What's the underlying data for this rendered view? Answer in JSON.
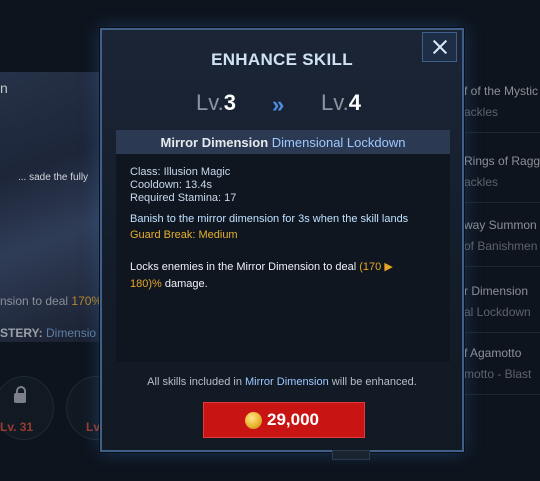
{
  "background": {
    "left_texts": {
      "top_fragment": "n",
      "art_caption": "... sade the fully",
      "deal_prefix": "nsion to deal ",
      "deal_value": "170",
      "deal_tail": "%",
      "mastery_label": "STERY:",
      "mastery_value": "Dimensio",
      "slot_lv_1": "Lv. 31",
      "slot_lv_2": "Lv"
    },
    "right_items": [
      {
        "line1": "f of the Mystic",
        "line2": "ackles"
      },
      {
        "line1": "Rings of Ragg",
        "line2": "ackles"
      },
      {
        "line1": "way Summon",
        "line2": "of Banishmen"
      },
      {
        "line1": "r Dimension",
        "line2": "al Lockdown"
      },
      {
        "line1": "f Agamotto",
        "line2": "motto - Blast"
      }
    ]
  },
  "modal": {
    "title": "ENHANCE SKILL",
    "current_level": {
      "prefix": "Lv.",
      "value": "3"
    },
    "arrow": "»",
    "next_level": {
      "prefix": "Lv.",
      "value": "4"
    },
    "skill_name": "Mirror Dimension",
    "skill_variant": "Dimensional Lockdown",
    "stats": {
      "class": "Class: Illusion Magic",
      "cooldown": "Cooldown: 13.4s",
      "stamina": "Required Stamina: 17"
    },
    "effect": "Banish to the mirror dimension for 3s when the skill lands",
    "guard_break": "Guard Break: Medium",
    "damage_desc": {
      "prefix": "Locks enemies in the Mirror Dimension to deal ",
      "from": "(170",
      "arrow": "▶",
      "to": "180)%",
      "suffix": " damage."
    },
    "footer_note": {
      "prefix": "All skills included in ",
      "highlight": "Mirror Dimension",
      "suffix": " will be enhanced."
    },
    "price": "29,000",
    "close_icon": "close-icon",
    "currency_icon": "gold-coin-icon"
  },
  "colors": {
    "accent_blue": "#9ec8ff",
    "gold": "#e6a527",
    "button_red": "#c91414",
    "frame": "#3f5f88"
  }
}
